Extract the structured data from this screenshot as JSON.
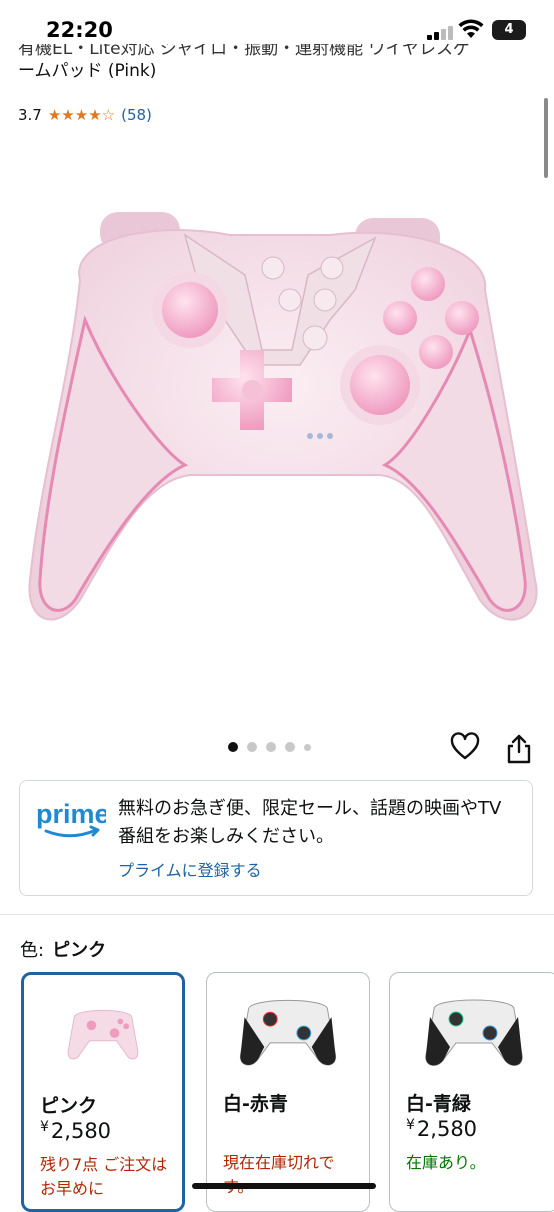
{
  "status_bar": {
    "time": "22:20",
    "battery": "4"
  },
  "product": {
    "title_line1": "有機EL・Lite対応 ジャイロ・振動・連射機能 ワイヤレスゲ",
    "title_line2": "ームパッド (Pink)",
    "rating": "3.7",
    "stars": "★★★★☆",
    "review_count": "(58)"
  },
  "gallery": {
    "image": "pink-game-controller",
    "dots": 5,
    "active_dot": 0
  },
  "actions": {
    "wishlist_icon": "heart-icon",
    "share_icon": "share-icon"
  },
  "prime": {
    "logo_text": "prime",
    "message": "無料のお急ぎ便、限定セール、話題の映画やTV番組をお楽しみください。",
    "link": "プライムに登録する"
  },
  "variation": {
    "label": "色:",
    "selected": "ピンク",
    "options": [
      {
        "name": "ピンク",
        "price_symbol": "¥",
        "price": "2,580",
        "stock": "残り7点 ご注文はお早めに",
        "stock_color": "#b12704"
      },
      {
        "name": "白-赤青",
        "price_symbol": "",
        "price": "",
        "stock": "現在在庫切れです。",
        "stock_color": "#b12704"
      },
      {
        "name": "白-青緑",
        "price_symbol": "¥",
        "price": "2,580",
        "stock": "在庫あり。",
        "stock_color": "#007600"
      }
    ]
  },
  "colors": {
    "link": "#2162a1",
    "star": "#de7921",
    "selected_border": "#2162a1"
  }
}
